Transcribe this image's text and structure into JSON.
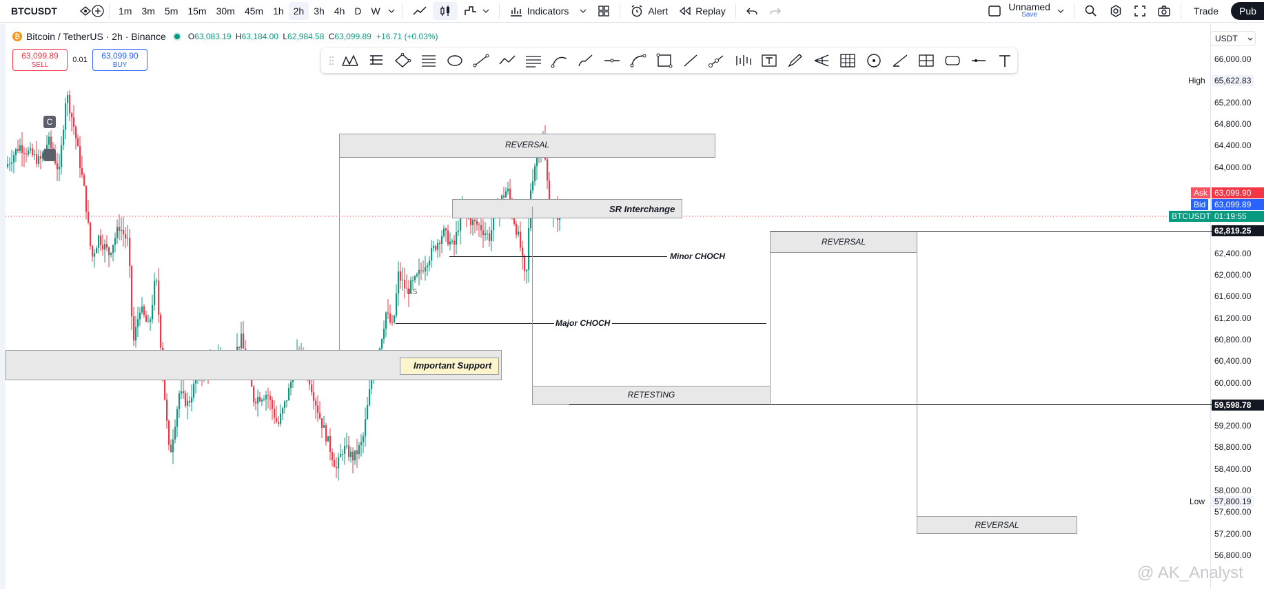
{
  "topbar": {
    "symbol": "BTCUSDT",
    "intervals": [
      "1m",
      "3m",
      "5m",
      "15m",
      "30m",
      "45m",
      "1h",
      "2h",
      "3h",
      "4h",
      "D",
      "W"
    ],
    "active_interval": "2h",
    "indicators_label": "Indicators",
    "alert_label": "Alert",
    "replay_label": "Replay",
    "layout_name": "Unnamed",
    "layout_save": "Save",
    "trade_label": "Trade",
    "publish_label": "Pub"
  },
  "legend": {
    "coin_glyph": "₿",
    "title": "Bitcoin / TetherUS · 2h · Binance",
    "o_label": "O",
    "o": "63,083.19",
    "h_label": "H",
    "h": "63,184.00",
    "l_label": "L",
    "l": "62,984.58",
    "c_label": "C",
    "c": "63,099.89",
    "change": "+16.71 (+0.03%)"
  },
  "order": {
    "sell_price": "63,099.89",
    "sell_label": "SELL",
    "qty": "0.01",
    "buy_price": "63,099.90",
    "buy_label": "BUY"
  },
  "price_scale": {
    "currency": "USDT",
    "ticks": [
      {
        "label": "66,000.00",
        "value": 66000
      },
      {
        "label": "65,200.00",
        "value": 65200
      },
      {
        "label": "64,800.00",
        "value": 64800
      },
      {
        "label": "64,400.00",
        "value": 64400
      },
      {
        "label": "64,000.00",
        "value": 64000
      },
      {
        "label": "62,400.00",
        "value": 62400
      },
      {
        "label": "62,000.00",
        "value": 62000
      },
      {
        "label": "61,600.00",
        "value": 61600
      },
      {
        "label": "61,200.00",
        "value": 61200
      },
      {
        "label": "60,800.00",
        "value": 60800
      },
      {
        "label": "60,400.00",
        "value": 60400
      },
      {
        "label": "60,000.00",
        "value": 60000
      },
      {
        "label": "59,200.00",
        "value": 59200
      },
      {
        "label": "58,800.00",
        "value": 58800
      },
      {
        "label": "58,400.00",
        "value": 58400
      },
      {
        "label": "58,000.00",
        "value": 58000
      },
      {
        "label": "57,600.00",
        "value": 57600
      },
      {
        "label": "57,200.00",
        "value": 57200
      },
      {
        "label": "56,800.00",
        "value": 56800
      }
    ],
    "high_label": "High",
    "high": "65,622.83",
    "low_label": "Low",
    "low": "57,800.19",
    "ask_label": "Ask",
    "ask": "63,099.90",
    "bid_label": "Bid",
    "bid": "63,099.89",
    "symbol_tag": "BTCUSDT",
    "countdown": "01:19:55",
    "level1": "62,819.25",
    "level2": "59,598.78"
  },
  "drawings": {
    "reversal_top": "REVERSAL",
    "sr_interchange": "SR Interchange",
    "minor_choch": "Minor CHOCH",
    "major_choch": "Major CHOCH",
    "important_support": "Important Support",
    "retesting": "RETESTING",
    "reversal_mid": "REVERSAL",
    "reversal_bottom": "REVERSAL",
    "fib_text": "0.5"
  },
  "markers": {
    "c": "C"
  },
  "watermark": "@ AK_Analyst",
  "colors": {
    "up": "#089981",
    "down": "#f23645",
    "accent": "#2962ff"
  }
}
